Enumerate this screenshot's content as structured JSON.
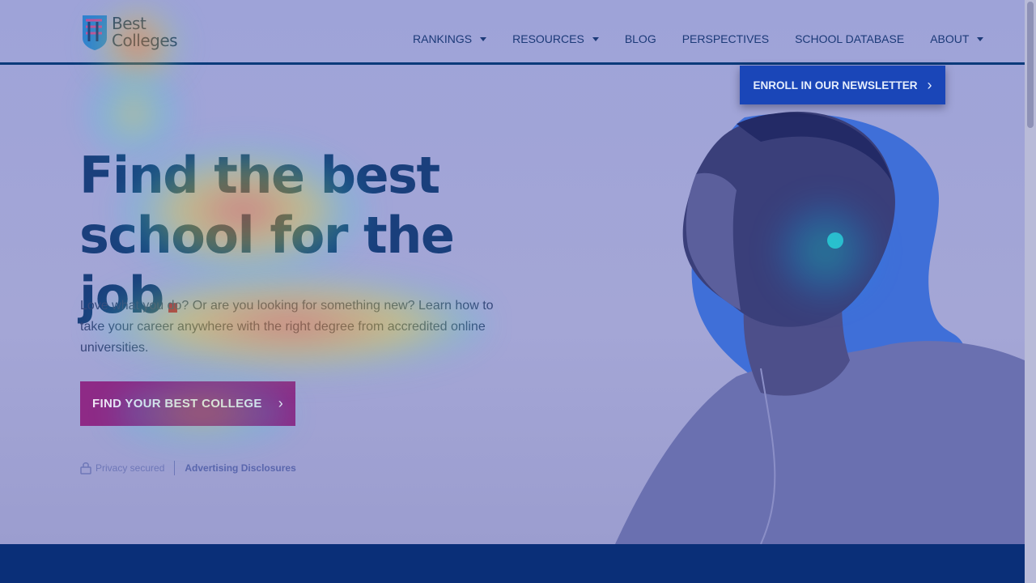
{
  "header": {
    "logo": {
      "line1": "Best",
      "line2": "Colleges"
    },
    "nav": [
      {
        "label": "RANKINGS",
        "dropdown": true
      },
      {
        "label": "RESOURCES",
        "dropdown": true
      },
      {
        "label": "BLOG",
        "dropdown": false
      },
      {
        "label": "PERSPECTIVES",
        "dropdown": false
      },
      {
        "label": "SCHOOL DATABASE",
        "dropdown": false
      },
      {
        "label": "ABOUT",
        "dropdown": true
      }
    ]
  },
  "newsletter": {
    "label": "ENROLL IN OUR NEWSLETTER",
    "icon": "chevron-right-icon"
  },
  "hero": {
    "headline_line1": "Find the best",
    "headline_line2": "school for the job",
    "headline_dot": ".",
    "lead": "Love what you do? Or are you looking for something new? Learn how to take your career anywhere with the right degree from accredited online universities.",
    "cta_label": "FIND YOUR BEST COLLEGE",
    "privacy_label": "Privacy secured",
    "advertising_label": "Advertising Disclosures"
  },
  "colors": {
    "brand_blue": "#1a46b8",
    "navy": "#0a2f78",
    "cta_magenta": "#8e2a86",
    "accent_dot": "#a0174d"
  }
}
